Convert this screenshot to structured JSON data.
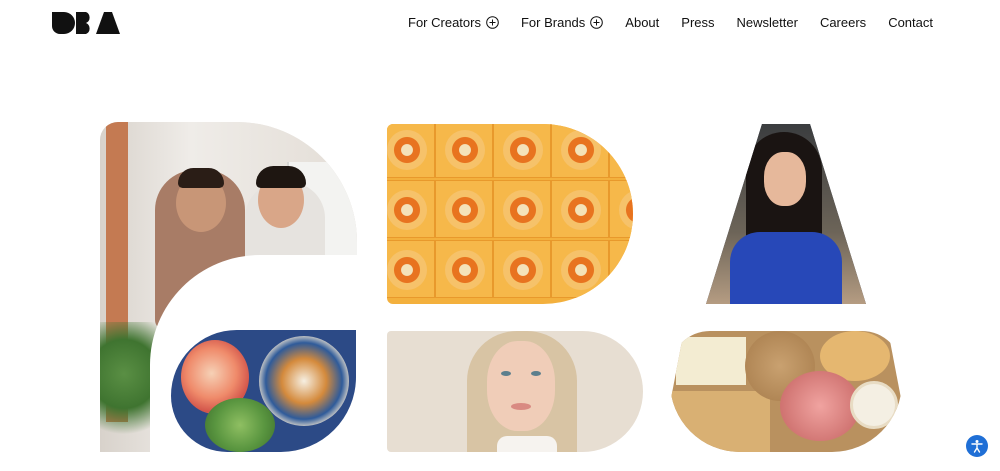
{
  "header": {
    "logo_text": "DBA",
    "nav": [
      {
        "label": "For Creators",
        "has_plus": true
      },
      {
        "label": "For Brands",
        "has_plus": true
      },
      {
        "label": "About",
        "has_plus": false
      },
      {
        "label": "Press",
        "has_plus": false
      },
      {
        "label": "Newsletter",
        "has_plus": false
      },
      {
        "label": "Careers",
        "has_plus": false
      },
      {
        "label": "Contact",
        "has_plus": false
      }
    ]
  },
  "icons": {
    "plus": "plus-circle-icon",
    "accessibility": "accessibility-icon"
  },
  "colors": {
    "accent_blue": "#1f6fd6",
    "text": "#111111",
    "background": "#ffffff"
  }
}
